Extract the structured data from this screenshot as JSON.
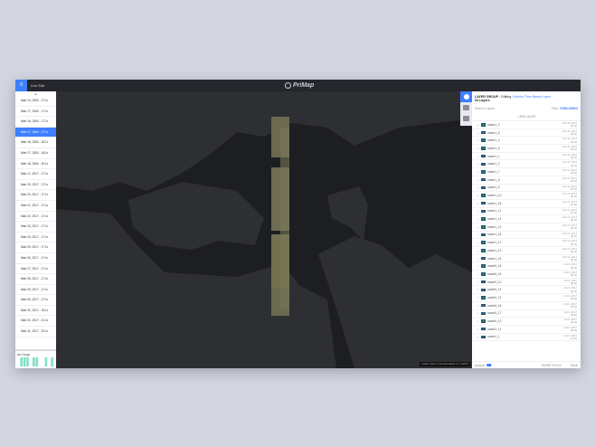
{
  "topbar": {
    "menu_icon": "menu-icon",
    "live_edit": "Live Edit",
    "logo": "PriMap"
  },
  "timeline": {
    "items": [
      "Mart 13, 2060 - 17:1x",
      "Mart 17, 2060 - 17:1x",
      "Mart 18, 2060 - 17:1x",
      "Mart 17, 2060 - 17:1x",
      "Mart 18, 2060 - 18:1x",
      "Mart 17, 2060 - 18:1x",
      "Mart 18, 2060 - 20:1x",
      "Mart 17, 2017 - 17:1x",
      "Mart 19, 2017 - 17:1x",
      "Mart 20, 2017 - 17:1x",
      "Mart 21, 2017 - 17:1x",
      "Mart 22, 2017 - 17:1x",
      "Mart 23, 2017 - 17:1x",
      "Mart 24, 2017 - 17:1x",
      "Mart 25, 2017 - 17:1x",
      "Mart 26, 2017 - 17:1x",
      "Mart 27, 2017 - 17:1x",
      "Mart 28, 2017 - 17:1x",
      "Mart 29, 2017 - 17:1x",
      "Mart 30, 2017 - 17:1x",
      "Mart 31, 2017 - 18:1x",
      "Mart 31, 2017 - 21:1x",
      "Mart 31, 2017 - 22:1x"
    ],
    "selected": 3,
    "ion_label": "Ion Group",
    "accent": "#3d7fff",
    "bar_color": "#7fe0c8"
  },
  "map": {
    "attribution": "Leaflet | Data © OpenStreetMap & © CARTO"
  },
  "panel": {
    "title": "LAYER GROUP",
    "editing": "- Editing",
    "layer_name": "Cebrüm Time Based Layer",
    "count": "54 Layers",
    "search_placeholder": "Search Layers",
    "filter_label": "Filter:",
    "filter_value": "PUBLISHED",
    "add_layer": "+ ADD LAYER",
    "layers": [
      [
        "raster1_3",
        "Oct 15, 2017",
        "00:00"
      ],
      [
        "raster1_5",
        "Oct 15, 2017",
        "00:00"
      ],
      [
        "raster1_4",
        "Oct 15, 2017",
        "00:00"
      ],
      [
        "raster1_6",
        "Oct 15, 2017",
        "00:00"
      ],
      [
        "raster1_1",
        "Oct 15, 2017",
        "00:00"
      ],
      [
        "raster1_2",
        "Oct 15, 2017",
        "00:00"
      ],
      [
        "raster1_7",
        "Oct 14, 2017",
        "00:00"
      ],
      [
        "raster1_8",
        "Oct 14, 2017",
        "00:00"
      ],
      [
        "raster1_9",
        "Oct 14, 2017",
        "00:00"
      ],
      [
        "raster1_10",
        "Oct 13, 2017",
        "00:00"
      ],
      [
        "raster1_18",
        "Oct 13, 2017",
        "00:00"
      ],
      [
        "raster1_11",
        "Oct 13, 2017",
        "00:00"
      ],
      [
        "raster1_14",
        "Oct 13, 2017",
        "00:00"
      ],
      [
        "raster1_12",
        "Oct 13, 2017",
        "00:00"
      ],
      [
        "raster1_16",
        "Oct 13, 2017",
        "00:00"
      ],
      [
        "raster1_17",
        "Oct 13, 2017",
        "00:00"
      ],
      [
        "raster1_13",
        "Oct 13, 2017",
        "00:00"
      ],
      [
        "raster1_15",
        "Oct 14, 2017",
        "00:00"
      ],
      [
        "raster5_18",
        "Oct 6, 2017",
        "00:00"
      ],
      [
        "raster5_19",
        "Oct 6, 2017",
        "00:00"
      ],
      [
        "raster5_10",
        "Oct 6, 2017",
        "00:00"
      ],
      [
        "raster5_14",
        "Oct 6, 2017",
        "00:00"
      ],
      [
        "raster5_12",
        "Oct 6, 2017",
        "00:00"
      ],
      [
        "raster5_16",
        "Oct 6, 2017",
        "00:00"
      ],
      [
        "raster5_17",
        "Oct 6, 2017",
        "00:00"
      ],
      [
        "raster5_13",
        "Oct 6, 2017",
        "00:00"
      ],
      [
        "raster2_11",
        "Oct 6, 2017",
        "00:00"
      ],
      [
        "raster2_1",
        "Oct 5, 2017",
        "13:00"
      ]
    ],
    "autorun_label": "Autorun",
    "autorun_on": true,
    "reset_style": "RESET STYLE",
    "save": "SAVE"
  }
}
